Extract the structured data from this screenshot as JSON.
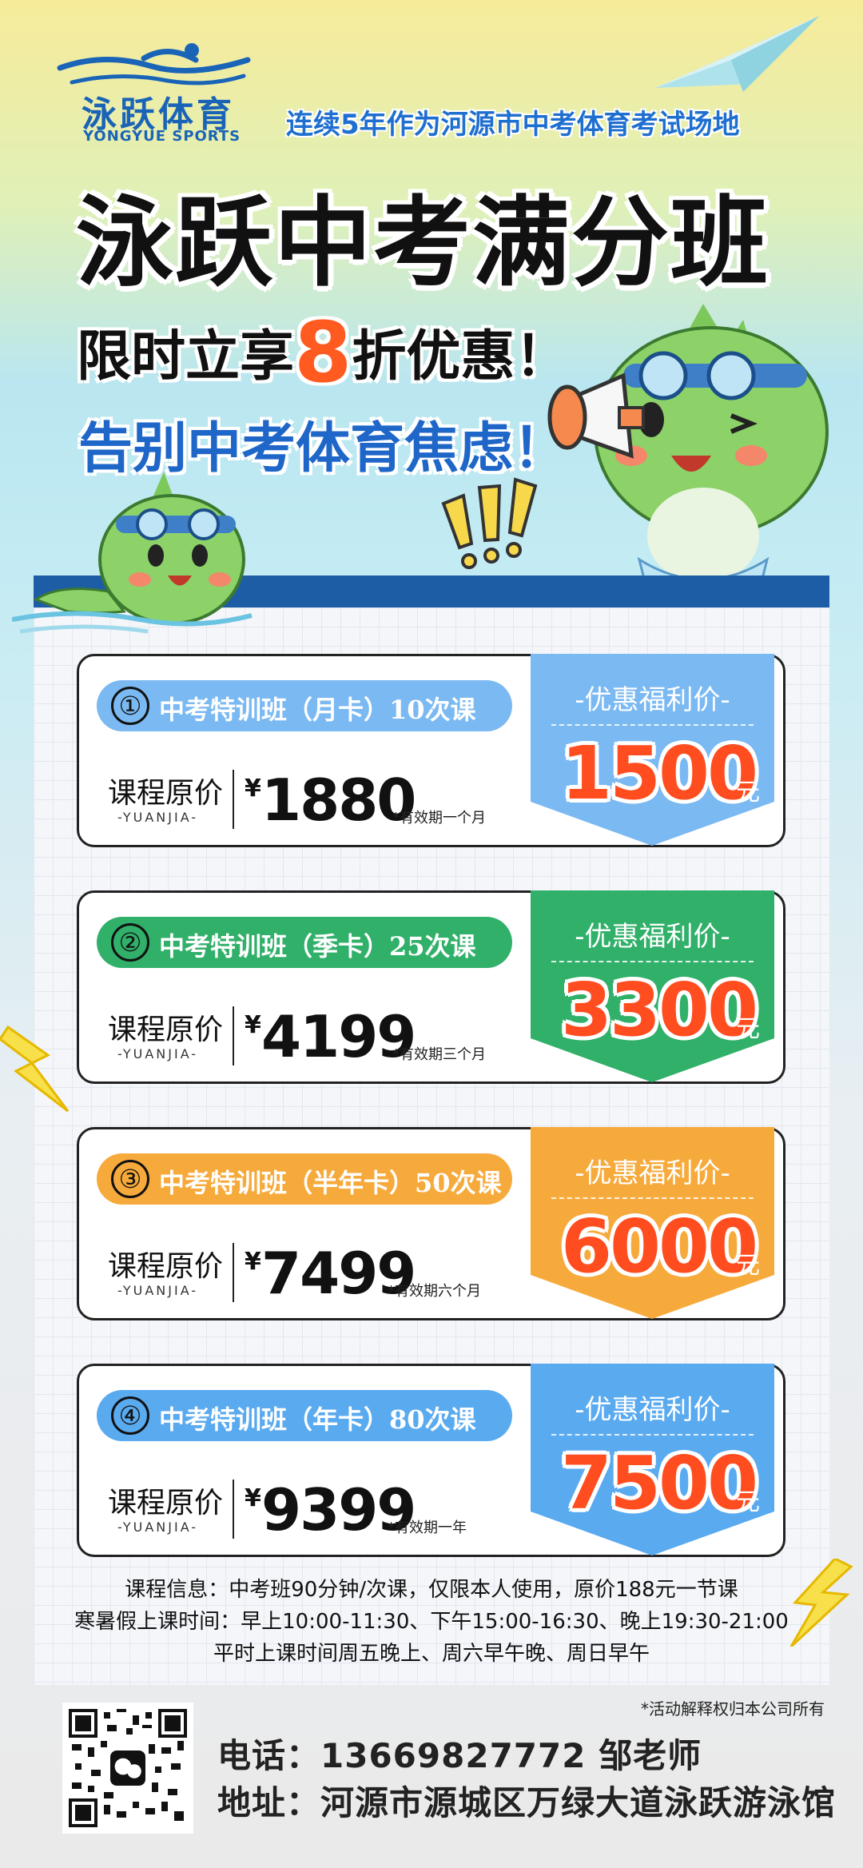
{
  "brand": {
    "name_cn": "泳跃体育",
    "name_en": "YONGYUE SPORTS"
  },
  "header": {
    "slogan": "连续5年作为河源市中考体育考试场地",
    "title": "泳跃中考满分班",
    "promo_prefix": "限时立享",
    "promo_number": "8",
    "promo_suffix": "折优惠！",
    "farewell": "告别中考体育焦虑！"
  },
  "cards": [
    {
      "num": "①",
      "name": "中考特训班（月卡）10次课",
      "orig_label": "课程原价",
      "orig_sub": "-YUANJIA-",
      "currency": "¥",
      "orig_price": "1880",
      "validity": "*有效期一个月",
      "sale_label": "-优惠福利价-",
      "sale_price": "1500",
      "unit": "元",
      "color": "#7bb9f2"
    },
    {
      "num": "②",
      "name": "中考特训班（季卡）25次课",
      "orig_label": "课程原价",
      "orig_sub": "-YUANJIA-",
      "currency": "¥",
      "orig_price": "4199",
      "validity": "*有效期三个月",
      "sale_label": "-优惠福利价-",
      "sale_price": "3300",
      "unit": "元",
      "color": "#31b06a"
    },
    {
      "num": "③",
      "name": "中考特训班（半年卡）50次课",
      "orig_label": "课程原价",
      "orig_sub": "-YUANJIA-",
      "currency": "¥",
      "orig_price": "7499",
      "validity": "*有效期六个月",
      "sale_label": "-优惠福利价-",
      "sale_price": "6000",
      "unit": "元",
      "color": "#f7aa3c"
    },
    {
      "num": "④",
      "name": "中考特训班（年卡）80次课",
      "orig_label": "课程原价",
      "orig_sub": "-YUANJIA-",
      "currency": "¥",
      "orig_price": "9399",
      "validity": "*有效期一年",
      "sale_label": "-优惠福利价-",
      "sale_price": "7500",
      "unit": "元",
      "color": "#5aaaf0"
    }
  ],
  "info": {
    "line1": "课程信息：中考班90分钟/次课，仅限本人使用，原价188元一节课",
    "line2": "寒暑假上课时间：早上10:00-11:30、下午15:00-16:30、晚上19:30-21:00",
    "line3": "平时上课时间周五晚上、周六早午晚、周日早午"
  },
  "footer": {
    "disclaimer": "*活动解释权归本公司所有",
    "phone": "电话：13669827772 邹老师",
    "address": "地址：河源市源城区万绿大道泳跃游泳馆"
  },
  "colors": {
    "accent_orange": "#ff4d1f",
    "brand_blue": "#1a64b8",
    "band_blue": "#1d5da6"
  }
}
